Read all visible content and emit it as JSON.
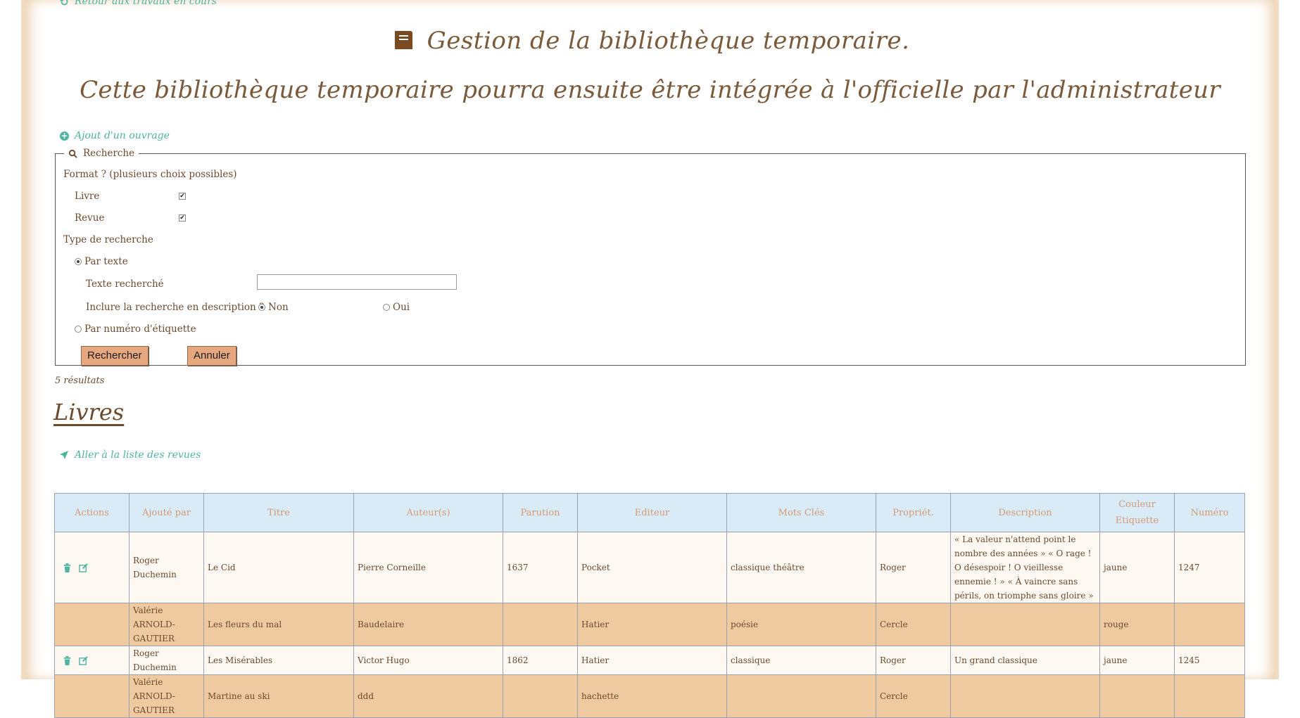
{
  "nav": {
    "back_label": "Retour aux travaux en cours",
    "add_label": "Ajout d'un ouvrage",
    "revues_label": "Aller à la liste des revues"
  },
  "header": {
    "title": "Gestion de la bibliothèque temporaire.",
    "subtitle": "Cette bibliothèque temporaire pourra ensuite être intégrée à l'officielle par l'administrateur"
  },
  "search": {
    "legend": "Recherche",
    "format_label": "Format ? (plusieurs choix possibles)",
    "formats": [
      {
        "label": "Livre",
        "checked": true
      },
      {
        "label": "Revue",
        "checked": true
      }
    ],
    "type_label": "Type de recherche",
    "by_text_label": "Par texte",
    "by_text_selected": true,
    "text_label": "Texte recherché",
    "text_value": "",
    "include_desc_label": "Inclure la recherche en description ?",
    "include_no": "Non",
    "include_yes": "Oui",
    "include_selected": "Non",
    "by_number_label": "Par numéro d'étiquette",
    "search_button": "Rechercher",
    "cancel_button": "Annuler"
  },
  "results_text": "5 résultats",
  "section_title": "Livres",
  "table": {
    "headers": [
      "Actions",
      "Ajouté par",
      "Titre",
      "Auteur(s)",
      "Parution",
      "Editeur",
      "Mots Clés",
      "Propriét.",
      "Description",
      "Couleur Etiquette",
      "Numéro"
    ],
    "rows": [
      {
        "actions": true,
        "added_by": "Roger Duchemin",
        "title": "Le Cid",
        "author": "Pierre Corneille",
        "year": "1637",
        "publisher": "Pocket",
        "keywords": "classique théâtre",
        "owner": "Roger",
        "description": "« La valeur n'attend point le nombre des années » « O rage ! O désespoir ! O vieillesse ennemie ! » « À vaincre sans périls, on triomphe sans gloire »",
        "color": "jaune",
        "number": "1247"
      },
      {
        "actions": false,
        "added_by": "Valérie ARNOLD-GAUTIER",
        "title": "Les fleurs du mal",
        "author": "Baudelaire",
        "year": "",
        "publisher": "Hatier",
        "keywords": "poésie",
        "owner": "Cercle",
        "description": "",
        "color": "rouge",
        "number": ""
      },
      {
        "actions": true,
        "added_by": "Roger Duchemin",
        "title": "Les Misérables",
        "author": "Victor Hugo",
        "year": "1862",
        "publisher": "Hatier",
        "keywords": "classique",
        "owner": "Roger",
        "description": "Un grand classique",
        "color": "jaune",
        "number": "1245"
      },
      {
        "actions": false,
        "added_by": "Valérie ARNOLD-GAUTIER",
        "title": "Martine au ski",
        "author": "ddd",
        "year": "",
        "publisher": "hachette",
        "keywords": "",
        "owner": "Cercle",
        "description": "",
        "color": "",
        "number": ""
      }
    ]
  },
  "colors": {
    "accent": "#4fb3a1",
    "text": "#6b4a2e",
    "header_bg": "#d9ebf7",
    "row_alt": "#efcaa0",
    "button_bg": "#e7a77f"
  }
}
